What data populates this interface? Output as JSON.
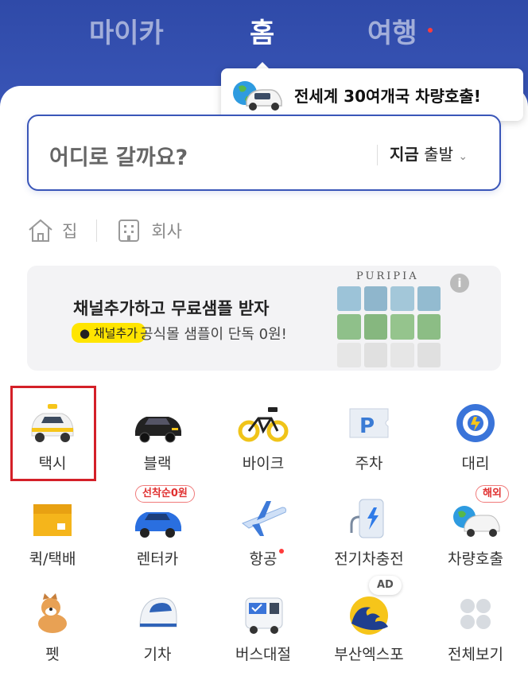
{
  "tabs": [
    {
      "label": "마이카"
    },
    {
      "label": "홈",
      "active": true
    },
    {
      "label": "여행",
      "has_dot": true
    }
  ],
  "tooltip": {
    "text": "전세계 30여개국 차량호출!"
  },
  "search": {
    "placeholder": "어디로 갈까요?",
    "time_bold": "지금",
    "time_rest": "출발"
  },
  "quick": [
    {
      "label": "집",
      "icon": "home-icon"
    },
    {
      "label": "회사",
      "icon": "building-icon"
    }
  ],
  "banner": {
    "title": "채널추가하고 무료샘플 받자",
    "chip": "채널추가",
    "subtitle": "공식몰 샘플이 단독 0원!",
    "brand": "PURIPIA"
  },
  "services": [
    {
      "label": "택시",
      "icon": "taxi-icon"
    },
    {
      "label": "블랙",
      "icon": "black-car-icon"
    },
    {
      "label": "바이크",
      "icon": "bike-icon"
    },
    {
      "label": "주차",
      "icon": "parking-icon"
    },
    {
      "label": "대리",
      "icon": "steering-wheel-icon"
    },
    {
      "label": "퀵/택배",
      "icon": "box-icon"
    },
    {
      "label": "렌터카",
      "icon": "rental-car-icon",
      "badge": "선착순0원"
    },
    {
      "label": "항공",
      "icon": "airplane-icon",
      "has_dot": true
    },
    {
      "label": "전기차충전",
      "icon": "ev-charger-icon"
    },
    {
      "label": "차량호출",
      "icon": "global-car-icon",
      "badge": "해외"
    },
    {
      "label": "펫",
      "icon": "dog-icon"
    },
    {
      "label": "기차",
      "icon": "train-icon"
    },
    {
      "label": "버스대절",
      "icon": "bus-icon"
    },
    {
      "label": "부산엑스포",
      "icon": "wave-icon",
      "badge": "AD"
    },
    {
      "label": "전체보기",
      "icon": "grid-dots-icon"
    }
  ],
  "colors": {
    "brand": "#2f4aa8",
    "highlight": "#d42028",
    "dot": "#ff3b3b",
    "chip": "#ffe500"
  }
}
